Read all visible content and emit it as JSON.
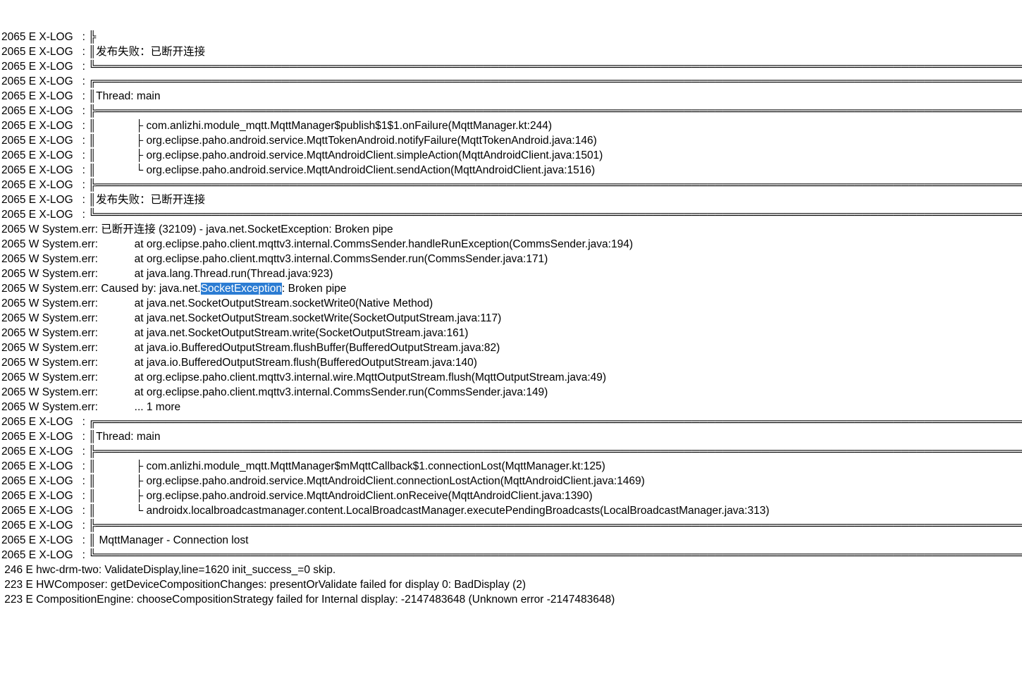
{
  "highlight": {
    "line_index": 17,
    "match": "SocketException"
  },
  "lines": [
    "2065 E X-LOG   : ╠",
    "2065 E X-LOG   : ║发布失败：已断开连接",
    "2065 E X-LOG   : ╚═══════════════════════════════════════════════════════════════════════════════════════════════════════════════════════════════════════════════════════════════════════════════════",
    "2065 E X-LOG   : ╔═══════════════════════════════════════════════════════════════════════════════════════════════════════════════════════════════════════════════════════════════════════════════════",
    "2065 E X-LOG   : ║Thread: main",
    "2065 E X-LOG   : ╠═══════════════════════════════════════════════════════════════════════════════════════════════════════════════════════════════════════════════════════════════════════════════════",
    "2065 E X-LOG   : ║             ├ com.anlizhi.module_mqtt.MqttManager$publish$1$1.onFailure(MqttManager.kt:244)",
    "2065 E X-LOG   : ║             ├ org.eclipse.paho.android.service.MqttTokenAndroid.notifyFailure(MqttTokenAndroid.java:146)",
    "2065 E X-LOG   : ║             ├ org.eclipse.paho.android.service.MqttAndroidClient.simpleAction(MqttAndroidClient.java:1501)",
    "2065 E X-LOG   : ║             └ org.eclipse.paho.android.service.MqttAndroidClient.sendAction(MqttAndroidClient.java:1516)",
    "2065 E X-LOG   : ╠═══════════════════════════════════════════════════════════════════════════════════════════════════════════════════════════════════════════════════════════════════════════════════",
    "2065 E X-LOG   : ║发布失败：已断开连接",
    "2065 E X-LOG   : ╚═══════════════════════════════════════════════════════════════════════════════════════════════════════════════════════════════════════════════════════════════════════════════════",
    "2065 W System.err: 已断开连接 (32109) - java.net.SocketException: Broken pipe",
    "2065 W System.err:            at org.eclipse.paho.client.mqttv3.internal.CommsSender.handleRunException(CommsSender.java:194)",
    "2065 W System.err:            at org.eclipse.paho.client.mqttv3.internal.CommsSender.run(CommsSender.java:171)",
    "2065 W System.err:            at java.lang.Thread.run(Thread.java:923)",
    "2065 W System.err: Caused by: java.net.SocketException: Broken pipe",
    "2065 W System.err:            at java.net.SocketOutputStream.socketWrite0(Native Method)",
    "2065 W System.err:            at java.net.SocketOutputStream.socketWrite(SocketOutputStream.java:117)",
    "2065 W System.err:            at java.net.SocketOutputStream.write(SocketOutputStream.java:161)",
    "2065 W System.err:            at java.io.BufferedOutputStream.flushBuffer(BufferedOutputStream.java:82)",
    "2065 W System.err:            at java.io.BufferedOutputStream.flush(BufferedOutputStream.java:140)",
    "2065 W System.err:            at org.eclipse.paho.client.mqttv3.internal.wire.MqttOutputStream.flush(MqttOutputStream.java:49)",
    "2065 W System.err:            at org.eclipse.paho.client.mqttv3.internal.CommsSender.run(CommsSender.java:149)",
    "2065 W System.err:            ... 1 more",
    "2065 E X-LOG   : ╔═══════════════════════════════════════════════════════════════════════════════════════════════════════════════════════════════════════════════════════════════════════════════════",
    "2065 E X-LOG   : ║Thread: main",
    "2065 E X-LOG   : ╠═══════════════════════════════════════════════════════════════════════════════════════════════════════════════════════════════════════════════════════════════════════════════════",
    "2065 E X-LOG   : ║             ├ com.anlizhi.module_mqtt.MqttManager$mMqttCallback$1.connectionLost(MqttManager.kt:125)",
    "2065 E X-LOG   : ║             ├ org.eclipse.paho.android.service.MqttAndroidClient.connectionLostAction(MqttAndroidClient.java:1469)",
    "2065 E X-LOG   : ║             ├ org.eclipse.paho.android.service.MqttAndroidClient.onReceive(MqttAndroidClient.java:1390)",
    "2065 E X-LOG   : ║             └ androidx.localbroadcastmanager.content.LocalBroadcastManager.executePendingBroadcasts(LocalBroadcastManager.java:313)",
    "2065 E X-LOG   : ╠═══════════════════════════════════════════════════════════════════════════════════════════════════════════════════════════════════════════════════════════════════════════════════",
    "2065 E X-LOG   : ║ MqttManager - Connection lost",
    "2065 E X-LOG   : ╚═══════════════════════════════════════════════════════════════════════════════════════════════════════════════════════════════════════════════════════════════════════════════════",
    " 246 E hwc-drm-two: ValidateDisplay,line=1620 init_success_=0 skip.",
    " 223 E HWComposer: getDeviceCompositionChanges: presentOrValidate failed for display 0: BadDisplay (2)",
    " 223 E CompositionEngine: chooseCompositionStrategy failed for Internal display: -2147483648 (Unknown error -2147483648)"
  ]
}
